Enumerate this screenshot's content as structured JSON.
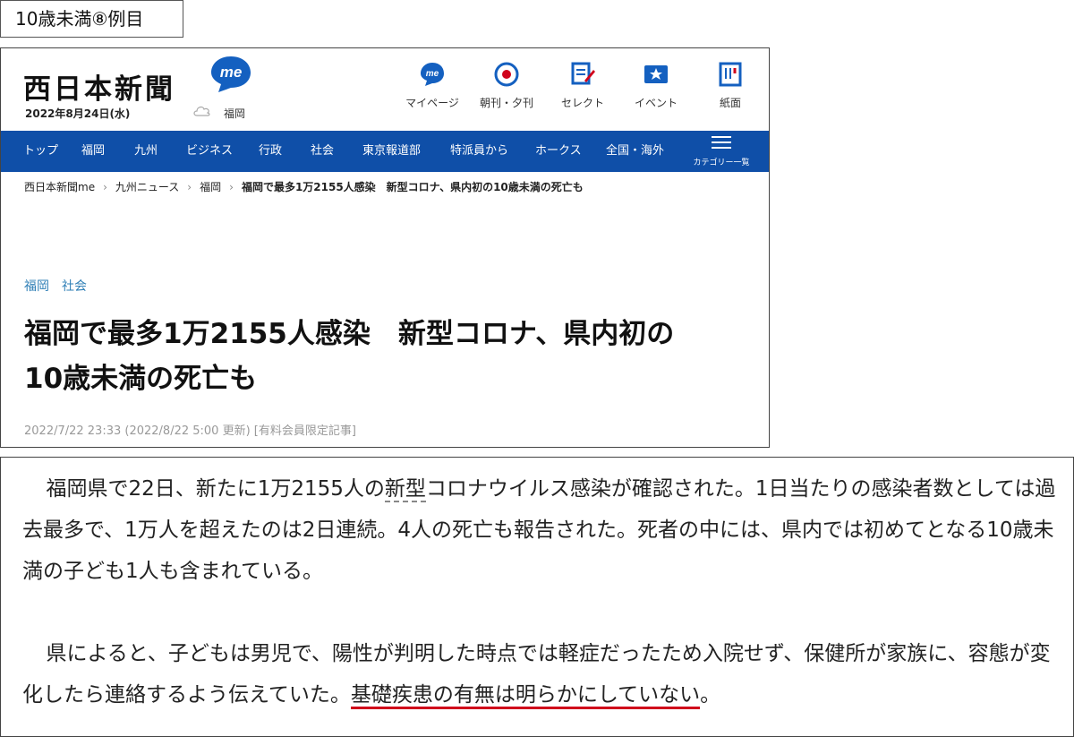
{
  "label": "10歳未満⑧例目",
  "site": {
    "logo": "西日本新聞",
    "badge": "me",
    "date": "2022年8月24日(水)",
    "city": "福岡"
  },
  "top_nav": [
    {
      "label": "マイページ",
      "icon": "me-icon"
    },
    {
      "label": "朝刊・夕刊",
      "icon": "newspaper-target-icon"
    },
    {
      "label": "セレクト",
      "icon": "select-icon"
    },
    {
      "label": "イベント",
      "icon": "event-icon"
    },
    {
      "label": "紙面",
      "icon": "paper-icon"
    }
  ],
  "menu": [
    "トップ",
    "福岡",
    "九州",
    "ビジネス",
    "行政",
    "社会",
    "東京報道部",
    "特派員から",
    "ホークス",
    "全国・海外"
  ],
  "menu_category": "カテゴリー一覧",
  "breadcrumb": [
    "西日本新聞me",
    "九州ニュース",
    "福岡",
    "福岡で最多1万2155人感染　新型コロナ、県内初の10歳未満の死亡も"
  ],
  "tags": [
    "福岡",
    "社会"
  ],
  "headline_line1": "福岡で最多1万2155人感染　新型コロナ、県内初の",
  "headline_line2": "10歳未満の死亡も",
  "meta": "2022/7/22 23:33 (2022/8/22 5:00 更新) [有料会員限定記事]",
  "body": {
    "p1_a": "福岡県で22日、新たに1万2155人の",
    "p1_b": "新型",
    "p1_c": "コロナウイルス感染が確認された。1日当たりの感染者数としては過去最多で、1万人を超えたのは2日連続。4人の死亡も報告された。死者の中には、県内では初めてとなる10歳未満の子ども1人も含まれている。",
    "p2_a": "県によると、子どもは男児で、陽性が判明した時点では軽症だったため入院せず、保健所が家族に、容態が変化したら連絡するよう伝えていた。",
    "p2_b": "基礎疾患の有無は明らかにしていない",
    "p2_c": "。"
  },
  "colors": {
    "menu_bg": "#0f4fa8",
    "tag": "#2f7fb6",
    "underline": "#d0021b",
    "accent": "#1460c0"
  }
}
